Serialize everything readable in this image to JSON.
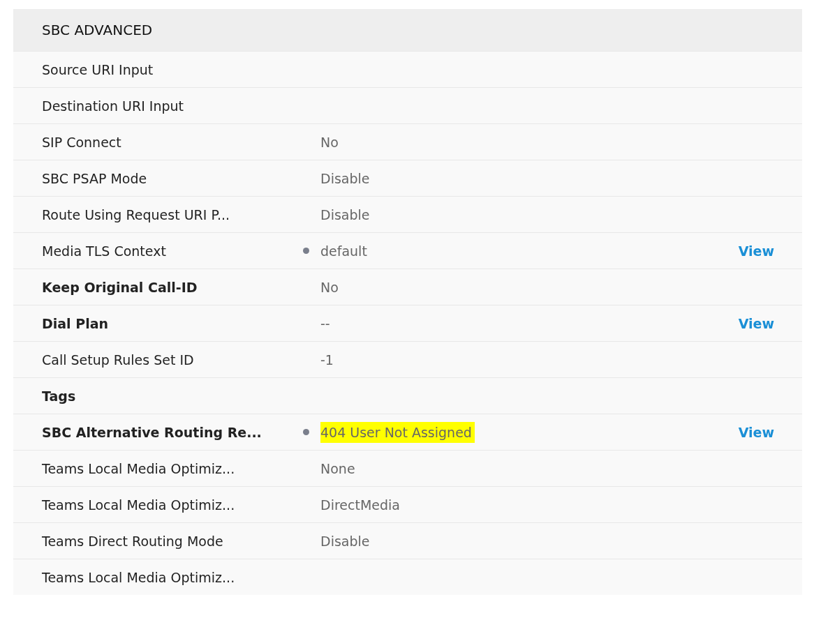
{
  "section": {
    "title": "SBC ADVANCED"
  },
  "rows": [
    {
      "label": "Source URI Input",
      "bold": false
    },
    {
      "label": "Destination URI Input",
      "bold": false
    },
    {
      "label": "SIP Connect",
      "bold": false,
      "value": "No"
    },
    {
      "label": "SBC PSAP Mode",
      "bold": false,
      "value": "Disable"
    },
    {
      "label": "Route Using Request URI P...",
      "bold": false,
      "value": "Disable"
    },
    {
      "label": "Media TLS Context",
      "bold": false,
      "dot": true,
      "value": "default",
      "link": "View"
    },
    {
      "label": "Keep Original Call-ID",
      "bold": true,
      "value": "No"
    },
    {
      "label": "Dial Plan",
      "bold": true,
      "value": "--",
      "link": "View"
    },
    {
      "label": "Call Setup Rules Set ID",
      "bold": false,
      "value": "-1"
    },
    {
      "label": "Tags",
      "bold": true
    },
    {
      "label": "SBC Alternative Routing Re...",
      "bold": true,
      "dot": true,
      "value": "404 User Not Assigned",
      "highlighted": true,
      "link": "View"
    },
    {
      "label": "Teams Local Media Optimiz...",
      "bold": false,
      "value": "None"
    },
    {
      "label": "Teams Local Media Optimiz...",
      "bold": false,
      "value": "DirectMedia"
    },
    {
      "label": "Teams Direct Routing Mode",
      "bold": false,
      "value": "Disable"
    },
    {
      "label": "Teams Local Media Optimiz...",
      "bold": false
    }
  ]
}
